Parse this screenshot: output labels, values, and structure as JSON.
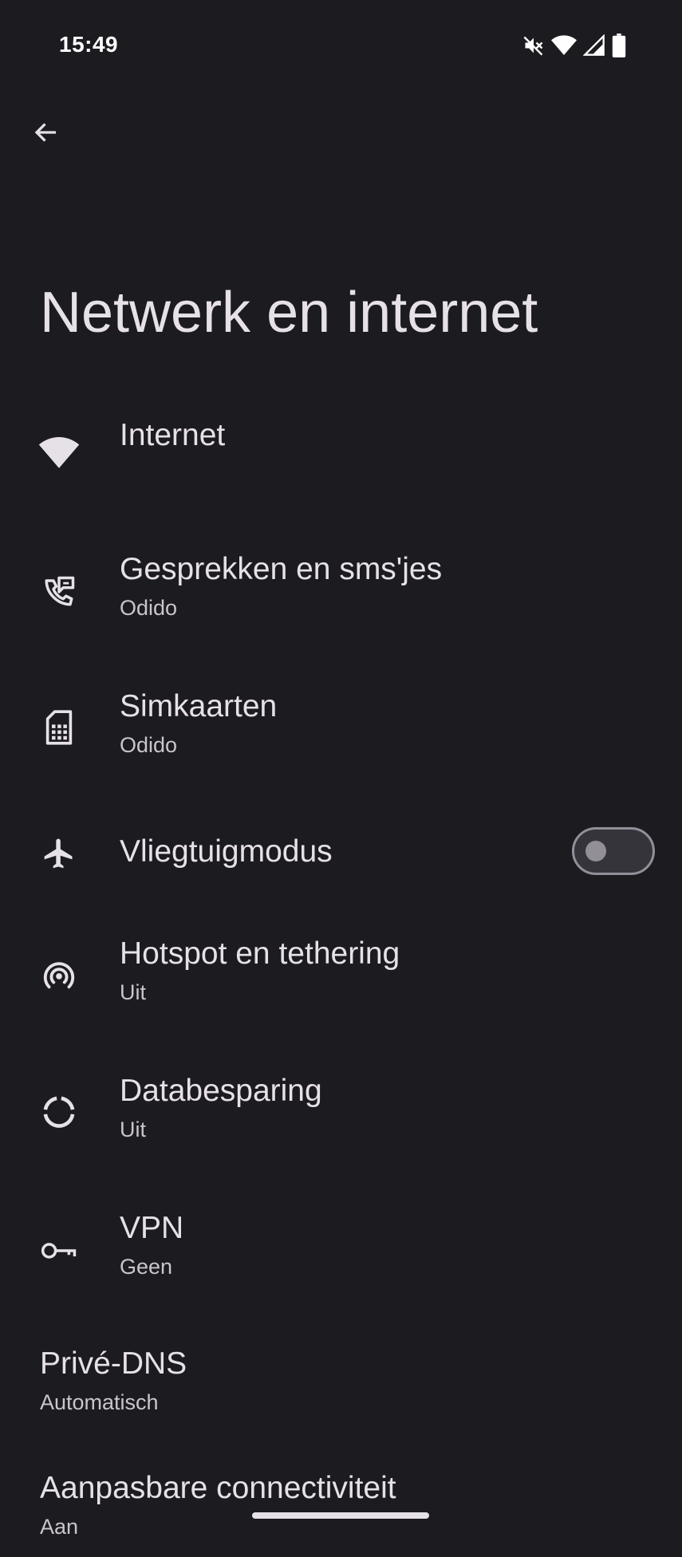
{
  "status_bar": {
    "time": "15:49",
    "icons": [
      "mute-icon",
      "wifi-icon",
      "cell-signal-icon",
      "battery-icon"
    ]
  },
  "header": {
    "back_icon": "arrow-left-icon",
    "title": "Netwerk en internet"
  },
  "items": [
    {
      "title": "Internet",
      "summary": "",
      "icon": "wifi-icon"
    },
    {
      "title": "Gesprekken en sms'jes",
      "summary": "Odido",
      "icon": "phone-message-icon"
    },
    {
      "title": "Simkaarten",
      "summary": "Odido",
      "icon": "sim-card-icon"
    },
    {
      "title": "Vliegtuigmodus",
      "summary": "",
      "icon": "airplane-icon",
      "toggle": false
    },
    {
      "title": "Hotspot en tethering",
      "summary": "Uit",
      "icon": "hotspot-icon"
    },
    {
      "title": "Databesparing",
      "summary": "Uit",
      "icon": "data-saver-icon"
    },
    {
      "title": "VPN",
      "summary": "Geen",
      "icon": "vpn-key-icon"
    },
    {
      "title": "Privé-DNS",
      "summary": "Automatisch",
      "icon": ""
    },
    {
      "title": "Aanpasbare connectiviteit",
      "summary": "Aan",
      "icon": ""
    }
  ],
  "colors": {
    "background": "#1c1b20",
    "text": "#e6e1e6",
    "secondary_text": "#c9c5ca",
    "toggle_off": "#938f99"
  }
}
